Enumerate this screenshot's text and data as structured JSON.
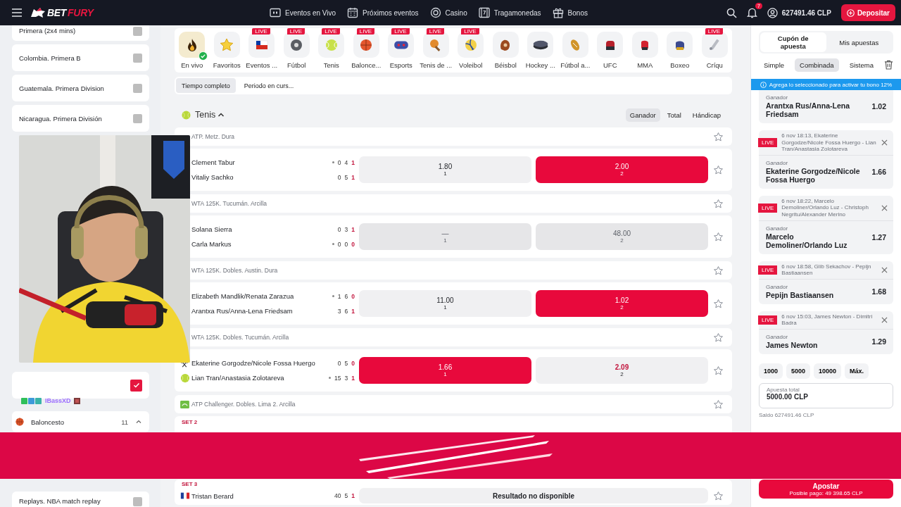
{
  "topbar": {
    "logo": {
      "first": "BET",
      "second": "FURY"
    },
    "nav": [
      {
        "label": "Eventos en Vivo"
      },
      {
        "label": "Próximos eventos"
      },
      {
        "label": "Casino"
      },
      {
        "label": "Tragamonedas"
      },
      {
        "label": "Bonos"
      }
    ],
    "notifications": "7",
    "balance": "627491.46 CLP",
    "deposit": "Depositar"
  },
  "sidebar": {
    "leagues": [
      {
        "label": "Primera (2x4 mins)",
        "checked": false
      },
      {
        "label": "Colombia. Primera B",
        "checked": false
      },
      {
        "label": "Guatemala. Primera Division",
        "checked": false
      },
      {
        "label": "Nicaragua. Primera División",
        "checked": false
      }
    ],
    "more_leagues": [
      {
        "checked": true
      }
    ],
    "category": {
      "name": "Baloncesto",
      "count": "11",
      "expanded": true
    },
    "bottom_leagues": [
      {
        "label": "Replays. NBA match replay",
        "checked": false
      }
    ]
  },
  "chat": [
    {
      "user": "IBassXD"
    }
  ],
  "sports": [
    {
      "label": "En vivo",
      "selected": true
    },
    {
      "label": "Favoritos",
      "selected": false
    },
    {
      "label": "Eventos ...",
      "badge": "LIVE",
      "selected": false
    },
    {
      "label": "Fútbol",
      "badge": "LIVE",
      "selected": false
    },
    {
      "label": "Tenis",
      "badge": "LIVE",
      "selected": false
    },
    {
      "label": "Balonce...",
      "badge": "LIVE",
      "selected": false
    },
    {
      "label": "Esports",
      "badge": "LIVE",
      "selected": false
    },
    {
      "label": "Tenis de ...",
      "badge": "LIVE",
      "selected": false
    },
    {
      "label": "Voleibol",
      "badge": "LIVE",
      "selected": false
    },
    {
      "label": "Béisbol",
      "selected": false
    },
    {
      "label": "Hockey ...",
      "selected": false
    },
    {
      "label": "Fútbol a...",
      "selected": false
    },
    {
      "label": "UFC",
      "selected": false
    },
    {
      "label": "MMA",
      "selected": false
    },
    {
      "label": "Boxeo",
      "selected": false
    },
    {
      "label": "Críqu",
      "badge": "LIVE",
      "selected": false
    }
  ],
  "periods": [
    {
      "label": "Tiempo completo",
      "selected": true
    },
    {
      "label": "Periodo en curs...",
      "selected": false
    }
  ],
  "section": {
    "title": "Tenis",
    "expanded": true,
    "markets": [
      {
        "label": "Ganador",
        "selected": true
      },
      {
        "label": "Total",
        "selected": false
      },
      {
        "label": "Hándicap",
        "selected": false
      }
    ]
  },
  "events": [
    {
      "league": "ATP. Metz. Dura",
      "matches": [
        {
          "players": [
            {
              "name": "Clement Tabur",
              "serving": true,
              "scores": [
                "0",
                "4",
                "1"
              ]
            },
            {
              "name": "Vitaliy Sachko",
              "serving": false,
              "scores": [
                "0",
                "5",
                "1"
              ]
            }
          ],
          "odds": [
            {
              "value": "1.80",
              "sub": "1",
              "selected": false,
              "disabled": false,
              "changed": false
            },
            {
              "value": "2.00",
              "sub": "2",
              "selected": true,
              "disabled": false,
              "changed": false
            }
          ]
        }
      ]
    },
    {
      "league": "WTA 125K. Tucumán. Arcilla",
      "matches": [
        {
          "players": [
            {
              "name": "Solana Sierra",
              "serving": false,
              "scores": [
                "0",
                "3",
                "1"
              ]
            },
            {
              "name": "Carla Markus",
              "serving": true,
              "scores": [
                "0",
                "0",
                "0"
              ]
            }
          ],
          "odds": [
            {
              "value": "—",
              "sub": "1",
              "selected": false,
              "disabled": true,
              "changed": false
            },
            {
              "value": "48.00",
              "sub": "2",
              "selected": false,
              "disabled": true,
              "changed": false
            }
          ]
        }
      ]
    },
    {
      "league": "WTA 125K. Dobles. Austin. Dura",
      "matches": [
        {
          "players": [
            {
              "name": "Elizabeth Mandlik/Renata Zarazua",
              "serving": true,
              "scores": [
                "1",
                "6",
                "0"
              ]
            },
            {
              "name": "Arantxa Rus/Anna-Lena Friedsam",
              "serving": false,
              "scores": [
                "3",
                "6",
                "1"
              ]
            }
          ],
          "odds": [
            {
              "value": "11.00",
              "sub": "1",
              "selected": false,
              "disabled": false,
              "changed": false
            },
            {
              "value": "1.02",
              "sub": "2",
              "selected": true,
              "disabled": false,
              "changed": false
            }
          ]
        }
      ]
    },
    {
      "league": "WTA 125K. Dobles. Tucumán. Arcilla",
      "matches": [
        {
          "players": [
            {
              "name": "Ekaterine Gorgodze/Nicole Fossa Huergo",
              "kind": "rackets",
              "serving": false,
              "scores": [
                "0",
                "5",
                "0"
              ]
            },
            {
              "name": "Lian Tran/Anastasia Zolotareva",
              "kind": "ball",
              "serving": true,
              "scores": [
                "15",
                "3",
                "1"
              ]
            }
          ],
          "odds": [
            {
              "value": "1.66",
              "sub": "1",
              "selected": true,
              "disabled": false,
              "changed": false
            },
            {
              "value": "2.09",
              "sub": "2",
              "selected": false,
              "disabled": false,
              "changed": true
            }
          ]
        }
      ]
    },
    {
      "league": "ATP Challenger. Dobles. Lima 2. Arcilla",
      "kind": "challenger",
      "matches": [
        {
          "set": "SET 2"
        }
      ]
    },
    {
      "matches": [
        {
          "set": "SET 3",
          "players": [
            {
              "name": "Tristan Berard",
              "kind": "flag",
              "serving": false,
              "scores": [
                "40",
                "5",
                "1"
              ]
            }
          ],
          "unavailable": "Resultado no disponible"
        }
      ]
    }
  ],
  "betslip": {
    "tabs": [
      {
        "label": "Cupón de apuesta",
        "selected": true
      },
      {
        "label": "Mis apuestas",
        "selected": false
      }
    ],
    "modes": [
      {
        "label": "Simple",
        "selected": false
      },
      {
        "label": "Combinada",
        "selected": true
      },
      {
        "label": "Sistema",
        "selected": false
      }
    ],
    "notice": "Agrega lo seleccionado para activar tu bono 12%",
    "bets": [
      {
        "market": "Ganador",
        "selection": "Arantxa Rus/Anna-Lena Friedsam",
        "odds": "1.02"
      },
      {
        "badge": "LIVE",
        "event": "6 nov 18:13, Ekaterine Gorgodze/Nicole Fossa Huergo - Lian Tran/Anastasia Zolotareva",
        "market": "Ganador",
        "selection": "Ekaterine Gorgodze/Nicole Fossa Huergo",
        "odds": "1.66"
      },
      {
        "badge": "LIVE",
        "event": "6 nov 18:22, Marcelo Demoliner/Orlando Luz - Christoph Negritu/Alexander Merino",
        "market": "Ganador",
        "selection": "Marcelo Demoliner/Orlando Luz",
        "odds": "1.27"
      },
      {
        "badge": "LIVE",
        "event": "6 nov 18:58, Glib Sekachov - Pepijn Bastiaansen",
        "market": "Ganador",
        "selection": "Pepijn Bastiaansen",
        "odds": "1.68"
      },
      {
        "badge": "LIVE",
        "event": "6 nov 15:03, James Newton - Dimitri Badra",
        "market": "Ganador",
        "selection": "James Newton",
        "odds": "1.29"
      }
    ],
    "quick_stakes": [
      "1000",
      "5000",
      "10000",
      "Máx."
    ],
    "stake": {
      "label": "Apuesta total",
      "value": "5000.00 CLP"
    },
    "balance": "Saldo 627491.46 CLP",
    "submit": {
      "label": "Apostar",
      "payout": "Posible pago: 49 398.65 CLP"
    }
  }
}
